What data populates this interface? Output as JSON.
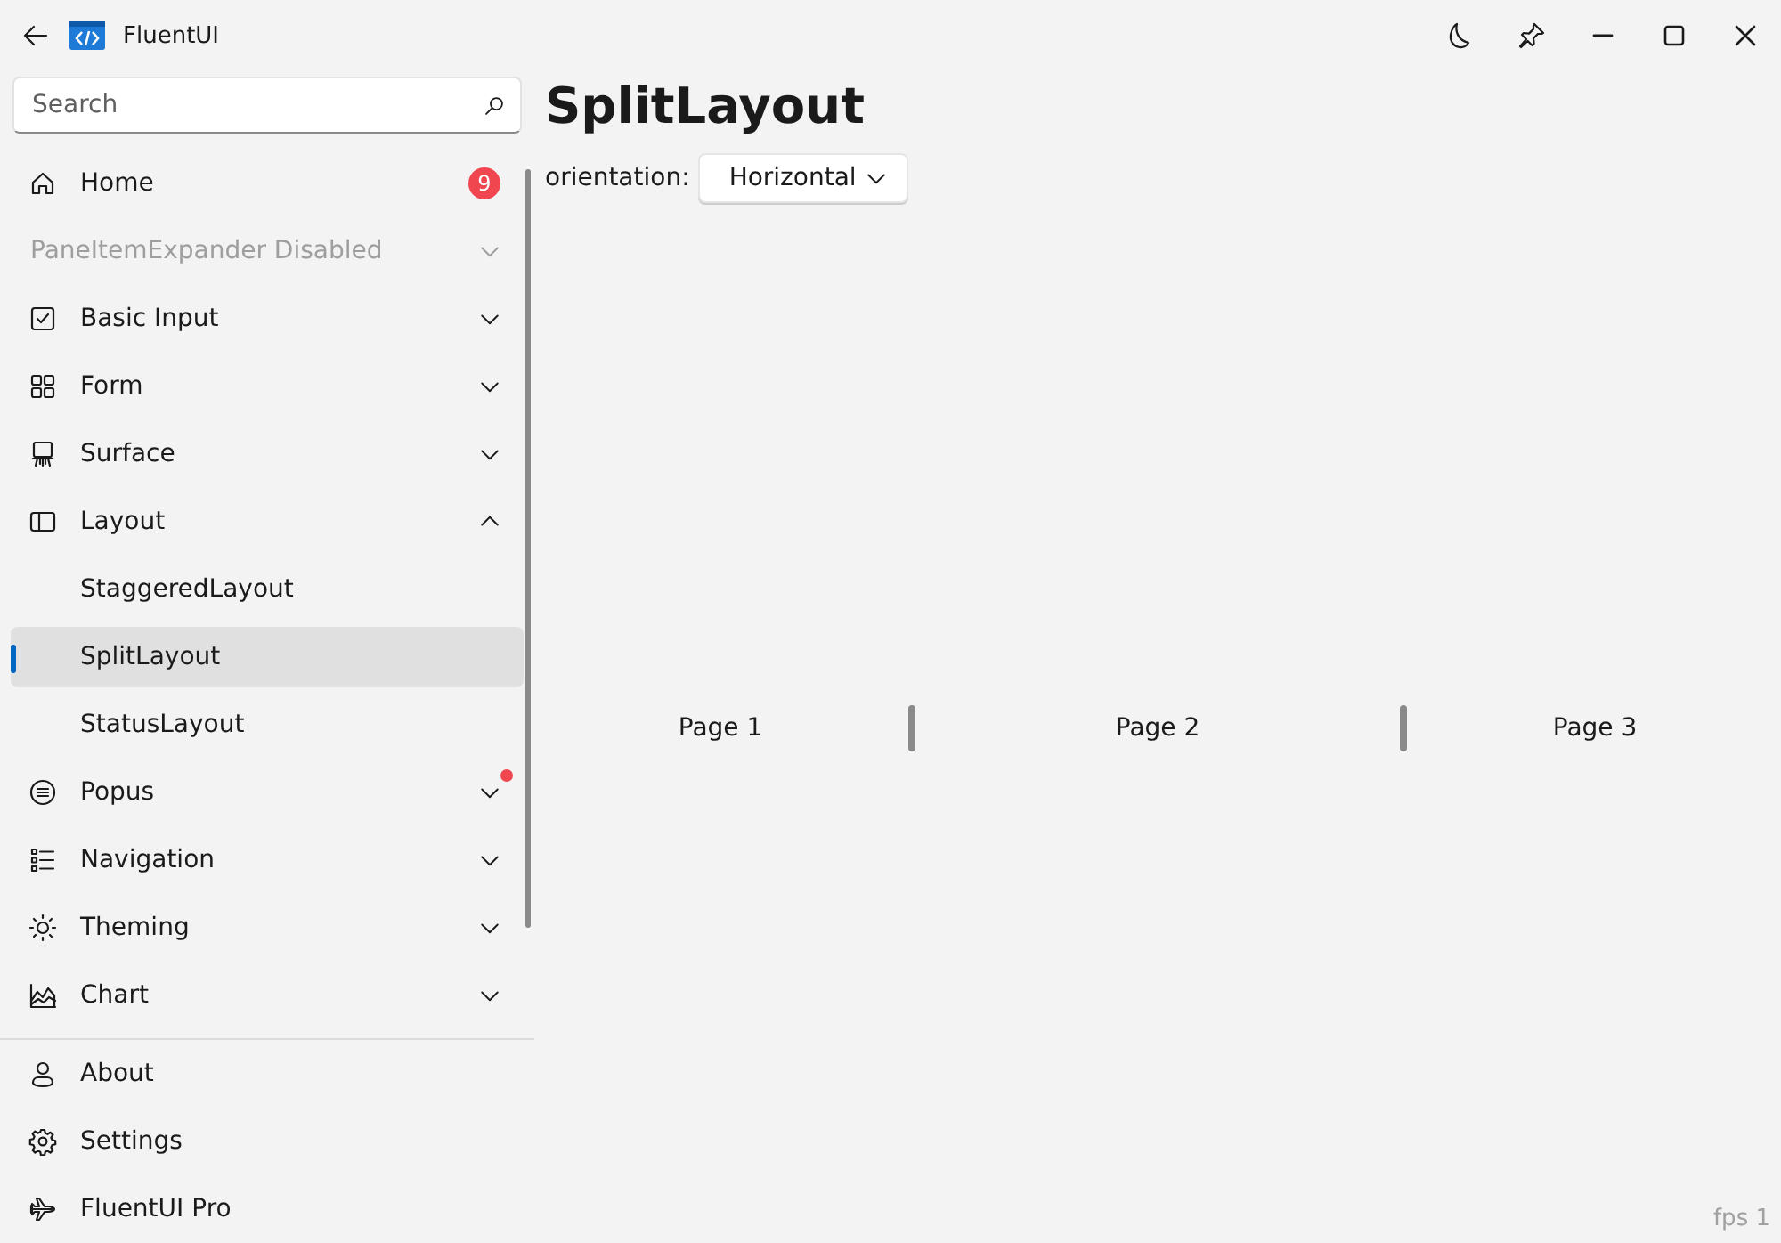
{
  "window": {
    "title": "FluentUI"
  },
  "search": {
    "placeholder": "Search"
  },
  "nav": [
    {
      "label": "Home",
      "kind": "item",
      "selected": false,
      "disabled": false,
      "badge": "9"
    },
    {
      "label": "PaneItemExpander Disabled",
      "kind": "expander",
      "selected": false,
      "disabled": true,
      "expanded": false
    },
    {
      "label": "Basic Input",
      "kind": "expander",
      "selected": false,
      "disabled": false,
      "expanded": false
    },
    {
      "label": "Form",
      "kind": "expander",
      "selected": false,
      "disabled": false,
      "expanded": false
    },
    {
      "label": "Surface",
      "kind": "expander",
      "selected": false,
      "disabled": false,
      "expanded": false
    },
    {
      "label": "Layout",
      "kind": "expander",
      "selected": false,
      "disabled": false,
      "expanded": true,
      "children": [
        {
          "label": "StaggeredLayout",
          "selected": false
        },
        {
          "label": "SplitLayout",
          "selected": true
        },
        {
          "label": "StatusLayout",
          "selected": false
        }
      ]
    },
    {
      "label": "Popus",
      "kind": "expander",
      "selected": false,
      "disabled": false,
      "expanded": false,
      "dot": true
    },
    {
      "label": "Navigation",
      "kind": "expander",
      "selected": false,
      "disabled": false,
      "expanded": false
    },
    {
      "label": "Theming",
      "kind": "expander",
      "selected": false,
      "disabled": false,
      "expanded": false
    },
    {
      "label": "Chart",
      "kind": "expander",
      "selected": false,
      "disabled": false,
      "expanded": false
    }
  ],
  "footer": [
    {
      "label": "About",
      "selected": false
    },
    {
      "label": "Settings",
      "selected": false
    },
    {
      "label": "FluentUI Pro",
      "selected": false
    }
  ],
  "page": {
    "title": "SplitLayout",
    "orientation_label": "orientation:",
    "orientation": "Horizontal",
    "panes": [
      "Page 1",
      "Page 2",
      "Page 3"
    ]
  },
  "fps": "fps 1"
}
